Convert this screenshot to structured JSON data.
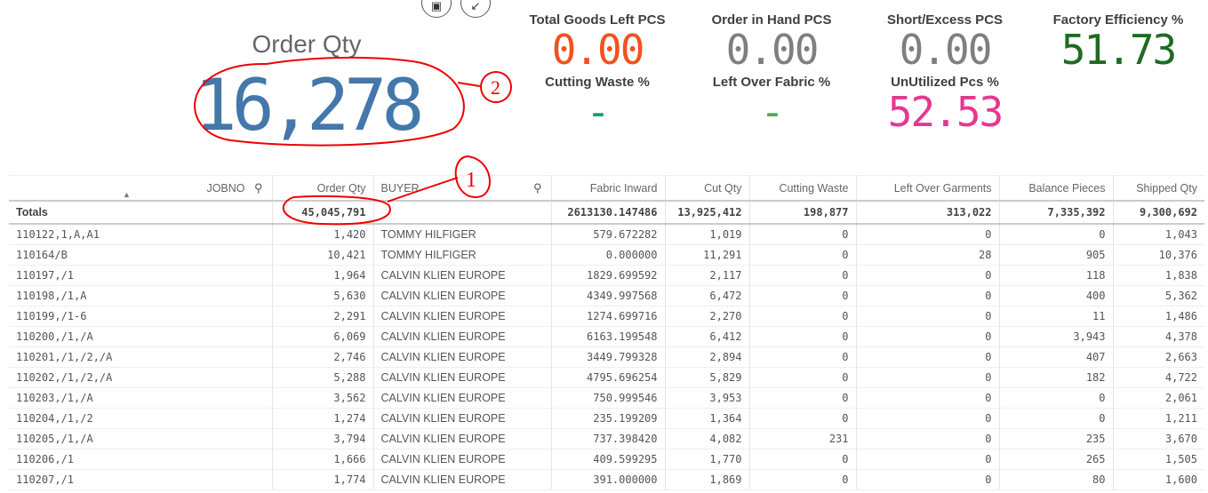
{
  "toolbar": {
    "snapshot": "camera-icon",
    "exit_fullscreen": "collapse-icon"
  },
  "big_kpi": {
    "title": "Order Qty",
    "value": "16,278",
    "color": "#4477aa"
  },
  "kpis": [
    {
      "title": "Total Goods Left PCS",
      "value": "0.00",
      "color": "#f4511e"
    },
    {
      "title": "Order in Hand PCS",
      "value": "0.00",
      "color": "#7f7f7f"
    },
    {
      "title": "Short/Excess PCS",
      "value": "0.00",
      "color": "#7f7f7f"
    },
    {
      "title": "Factory Efficiency %",
      "value": "51.73",
      "color": "#1e6b24"
    },
    {
      "title": "Cutting Waste %",
      "value": "-",
      "color": "#1a9e77"
    },
    {
      "title": "Left Over Fabric %",
      "value": "-",
      "color": "#4caf50"
    },
    {
      "title": "UnUtilized Pcs %",
      "value": "52.53",
      "color": "#e8368f"
    }
  ],
  "annotations": {
    "one": "1",
    "two": "2"
  },
  "table": {
    "headers": [
      "JOBNO",
      "Order Qty",
      "BUYER",
      "Fabric Inward",
      "Cut Qty",
      "Cutting Waste",
      "Left Over Garments",
      "Balance Pieces",
      "Shipped Qty"
    ],
    "totals": [
      "Totals",
      "45,045,791",
      "",
      "2613130.147486",
      "13,925,412",
      "198,877",
      "313,022",
      "7,335,392",
      "9,300,692"
    ],
    "rows": [
      [
        "110122,1,A,A1",
        "1,420",
        "TOMMY HILFIGER",
        "579.672282",
        "1,019",
        "0",
        "0",
        "0",
        "1,043"
      ],
      [
        "110164/B",
        "10,421",
        "TOMMY HILFIGER",
        "0.000000",
        "11,291",
        "0",
        "28",
        "905",
        "10,376"
      ],
      [
        "110197,/1",
        "1,964",
        "CALVIN KLIEN EUROPE",
        "1829.699592",
        "2,117",
        "0",
        "0",
        "118",
        "1,838"
      ],
      [
        "110198,/1,A",
        "5,630",
        "CALVIN KLIEN EUROPE",
        "4349.997568",
        "6,472",
        "0",
        "0",
        "400",
        "5,362"
      ],
      [
        "110199,/1-6",
        "2,291",
        "CALVIN KLIEN EUROPE",
        "1274.699716",
        "2,270",
        "0",
        "0",
        "11",
        "1,486"
      ],
      [
        "110200,/1,/A",
        "6,069",
        "CALVIN KLIEN EUROPE",
        "6163.199548",
        "6,412",
        "0",
        "0",
        "3,943",
        "4,378"
      ],
      [
        "110201,/1,/2,/A",
        "2,746",
        "CALVIN KLIEN EUROPE",
        "3449.799328",
        "2,894",
        "0",
        "0",
        "407",
        "2,663"
      ],
      [
        "110202,/1,/2,/A",
        "5,288",
        "CALVIN KLIEN EUROPE",
        "4795.696254",
        "5,829",
        "0",
        "0",
        "182",
        "4,722"
      ],
      [
        "110203,/1,/A",
        "3,562",
        "CALVIN KLIEN EUROPE",
        "750.999546",
        "3,953",
        "0",
        "0",
        "0",
        "2,061"
      ],
      [
        "110204,/1,/2",
        "1,274",
        "CALVIN KLIEN EUROPE",
        "235.199209",
        "1,364",
        "0",
        "0",
        "0",
        "1,211"
      ],
      [
        "110205,/1,/A",
        "3,794",
        "CALVIN KLIEN EUROPE",
        "737.398420",
        "4,082",
        "231",
        "0",
        "235",
        "3,670"
      ],
      [
        "110206,/1",
        "1,666",
        "CALVIN KLIEN EUROPE",
        "409.599295",
        "1,770",
        "0",
        "0",
        "265",
        "1,505"
      ],
      [
        "110207,/1",
        "1,774",
        "CALVIN KLIEN EUROPE",
        "391.000000",
        "1,869",
        "0",
        "0",
        "80",
        "1,600"
      ]
    ]
  }
}
